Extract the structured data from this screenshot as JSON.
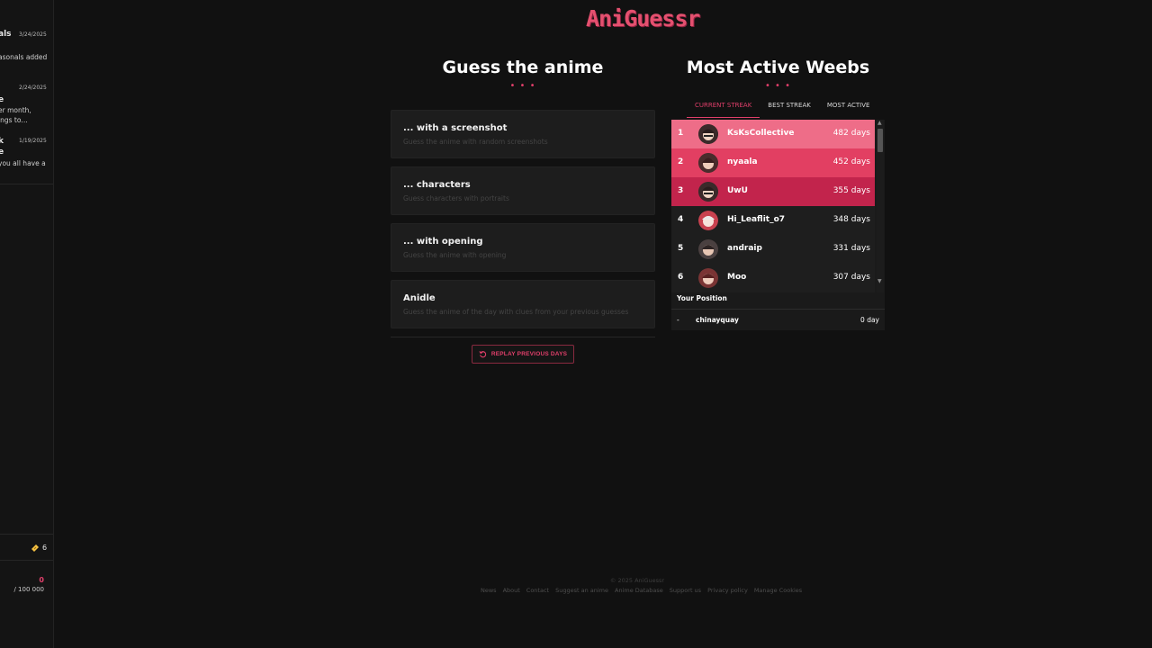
{
  "sidebar": {
    "news": [
      {
        "title": "als",
        "date": "3/24/2025",
        "lines": [
          "asonals added",
          "."
        ]
      },
      {
        "title": "e",
        "date": "2/24/2025",
        "lines": [
          "er month,",
          "ings to…"
        ]
      },
      {
        "title": "k",
        "date": "1/19/2025",
        "subtitle": "e",
        "lines": [
          "you all have a"
        ]
      }
    ],
    "tickets": "6",
    "score": "0",
    "score_total": "/ 100 000"
  },
  "logo": "AniGuessr",
  "guess": {
    "title": "Guess the anime",
    "modes": [
      {
        "title": "... with a screenshot",
        "description": "Guess the anime with random screenshots"
      },
      {
        "title": "... characters",
        "description": "Guess characters with portraits"
      },
      {
        "title": "... with opening",
        "description": "Guess the anime with opening"
      },
      {
        "title": "Anidle",
        "description": "Guess the anime of the day with clues from your previous guesses"
      }
    ],
    "replay_label": "REPLAY PREVIOUS DAYS"
  },
  "leaderboard": {
    "title": "Most Active Weebs",
    "tabs": [
      "CURRENT STREAK",
      "BEST STREAK",
      "MOST ACTIVE"
    ],
    "rows": [
      {
        "rank": "1",
        "name": "KsKsCollective",
        "days": "482 days"
      },
      {
        "rank": "2",
        "name": "nyaala",
        "days": "452 days"
      },
      {
        "rank": "3",
        "name": "UwU",
        "days": "355 days"
      },
      {
        "rank": "4",
        "name": "Hi_Leaflit_o7",
        "days": "348 days"
      },
      {
        "rank": "5",
        "name": "andraip",
        "days": "331 days"
      },
      {
        "rank": "6",
        "name": "Moo",
        "days": "307 days"
      }
    ],
    "position_label": "Your Position",
    "my_position": {
      "rank": "-",
      "name": "chinayquay",
      "days": "0 day"
    }
  },
  "footer": {
    "copyright": "© 2025 AniGuessr",
    "links": [
      "News",
      "About",
      "Contact",
      "Suggest an anime",
      "Anime Database",
      "Support us",
      "Privacy policy",
      "Manage Cookies"
    ]
  },
  "colors": {
    "accent": "#e23f6b",
    "background": "#111111",
    "card": "#1d1d1d"
  }
}
